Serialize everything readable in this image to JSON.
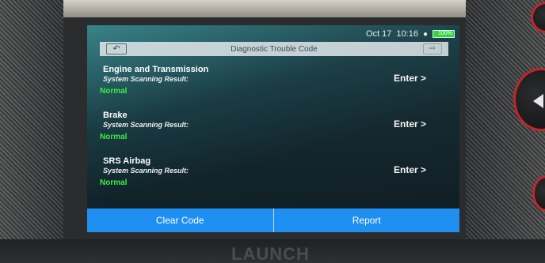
{
  "status": {
    "date": "Oct 17",
    "time": "10:16",
    "battery": "100%"
  },
  "header": {
    "title": "Diagnostic Trouble Code",
    "back_icon": "back-arrow-icon",
    "exit_icon": "exit-icon"
  },
  "systems": [
    {
      "name": "Engine and Transmission",
      "scan_label": "System Scanning Result:",
      "result": "Normal",
      "enter": "Enter >"
    },
    {
      "name": "Brake",
      "scan_label": "System Scanning Result:",
      "result": "Normal",
      "enter": "Enter >"
    },
    {
      "name": "SRS Airbag",
      "scan_label": "System Scanning Result:",
      "result": "Normal",
      "enter": "Enter >"
    }
  ],
  "actions": {
    "clear_code": "Clear Code",
    "report": "Report"
  },
  "device": {
    "brand": "LAUNCH"
  },
  "colors": {
    "accent": "#1f8ff2",
    "ok": "#38f040",
    "hardware_ring": "#c0252b"
  }
}
